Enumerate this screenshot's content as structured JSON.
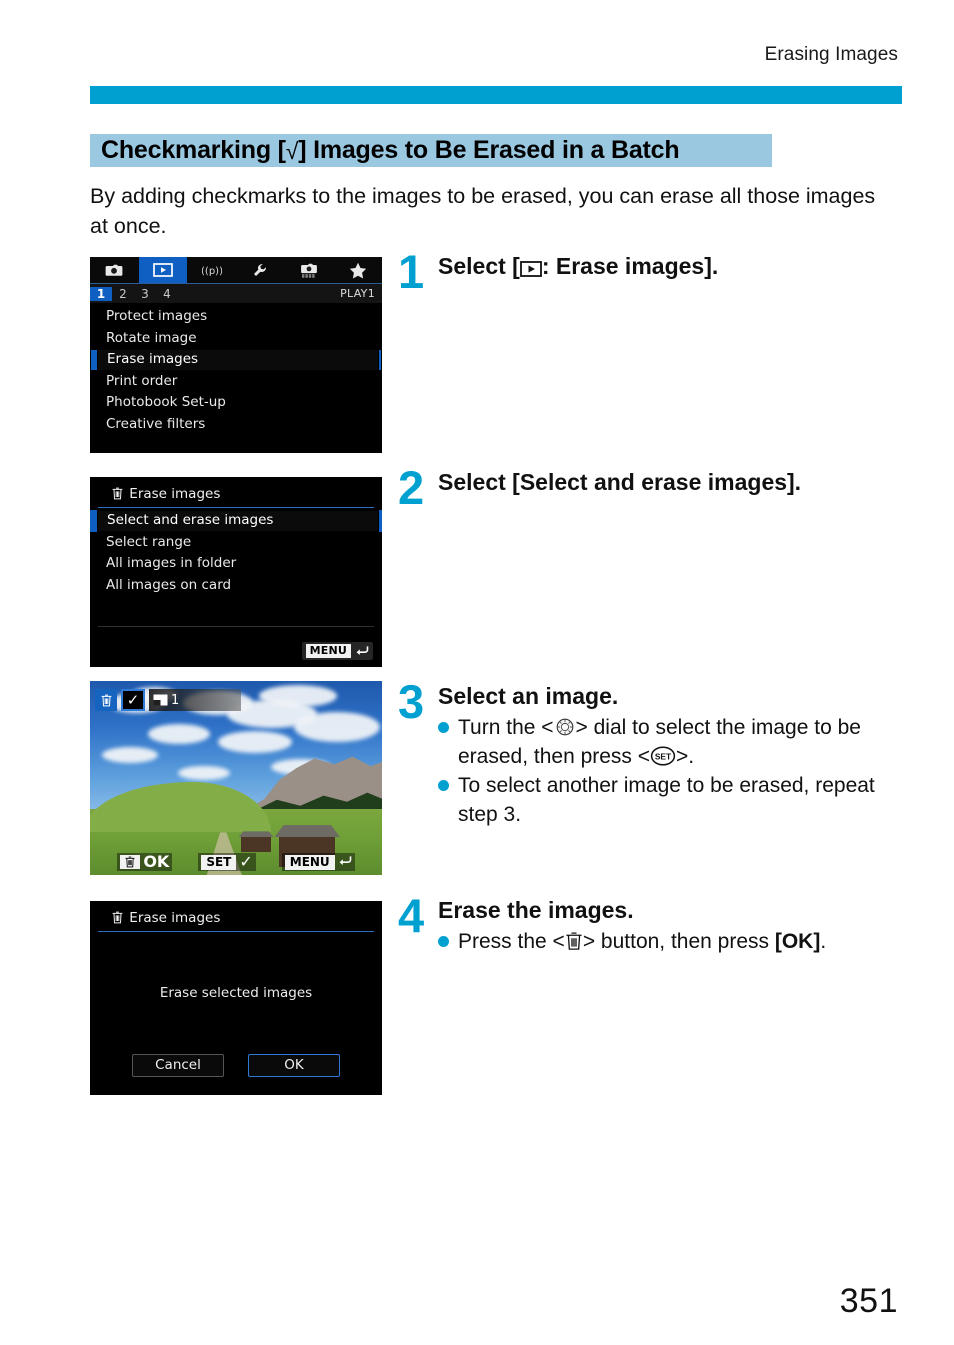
{
  "header": {
    "running_title": "Erasing Images",
    "rule_color": "#00a0d0"
  },
  "section": {
    "heading_before": "Checkmarking [",
    "heading_mark": "√",
    "heading_after": "] Images to Be Erased in a Batch",
    "heading_bg": "#9ac8e0",
    "intro": "By adding checkmarks to the images to be erased, you can erase all those images at once."
  },
  "screens": {
    "menu_screen": {
      "tabs": [
        {
          "icon": "camera-icon",
          "active": false
        },
        {
          "icon": "playback-icon",
          "active": true
        },
        {
          "icon": "wireless-icon",
          "active": false
        },
        {
          "icon": "wrench-icon",
          "active": false
        },
        {
          "icon": "custom-functions-icon",
          "active": false
        },
        {
          "icon": "star-icon",
          "active": false
        }
      ],
      "page_numbers": [
        "1",
        "2",
        "3",
        "4"
      ],
      "selected_page": "1",
      "page_label": "PLAY1",
      "items": [
        {
          "label": "Protect images",
          "selected": false
        },
        {
          "label": "Rotate image",
          "selected": false
        },
        {
          "label": "Erase images",
          "selected": true
        },
        {
          "label": "Print order",
          "selected": false
        },
        {
          "label": "Photobook Set-up",
          "selected": false
        },
        {
          "label": "Creative filters",
          "selected": false
        }
      ]
    },
    "erase_options_screen": {
      "title": "Erase images",
      "title_icon": "trash-icon",
      "options": [
        {
          "label": "Select and erase images",
          "selected": true
        },
        {
          "label": "Select range",
          "selected": false
        },
        {
          "label": "All images in folder",
          "selected": false
        },
        {
          "label": "All images on card",
          "selected": false
        }
      ],
      "menu_badge": "MENU",
      "menu_badge_icon": "return-arrow-icon"
    },
    "image_select_screen": {
      "trash_icon": "trash-icon",
      "check_mark": "✓",
      "card_icon": "image-card-icon",
      "count": "1",
      "bottom_bar": [
        {
          "key_icon": "trash-icon",
          "key_text": "",
          "label": "OK"
        },
        {
          "key_icon": "",
          "key_text": "SET",
          "label": "✓"
        },
        {
          "key_icon": "",
          "key_text": "MENU",
          "label": "↩"
        }
      ]
    },
    "confirm_screen": {
      "title": "Erase images",
      "title_icon": "trash-icon",
      "message": "Erase selected images",
      "cancel_label": "Cancel",
      "ok_label": "OK"
    }
  },
  "steps": [
    {
      "number": "1",
      "title_before": "Select [",
      "title_icon": "playback-icon",
      "title_after": ": Erase images].",
      "bullets": []
    },
    {
      "number": "2",
      "title": "Select [Select and erase images].",
      "bullets": []
    },
    {
      "number": "3",
      "title": "Select an image.",
      "bullets": [
        {
          "part1": "Turn the <",
          "icon": "quick-control-dial-icon",
          "part2": "> dial to select the image to be erased, then press <",
          "icon2": "set-button-icon",
          "part3": ">."
        },
        {
          "text": "To select another image to be erased, repeat step 3."
        }
      ]
    },
    {
      "number": "4",
      "title": "Erase the images.",
      "bullets": [
        {
          "part1": "Press the <",
          "icon": "trash-icon",
          "part2": "> button, then press ",
          "bold": "[OK]",
          "part3": "."
        }
      ]
    }
  ],
  "footer": {
    "page_number": "351"
  }
}
